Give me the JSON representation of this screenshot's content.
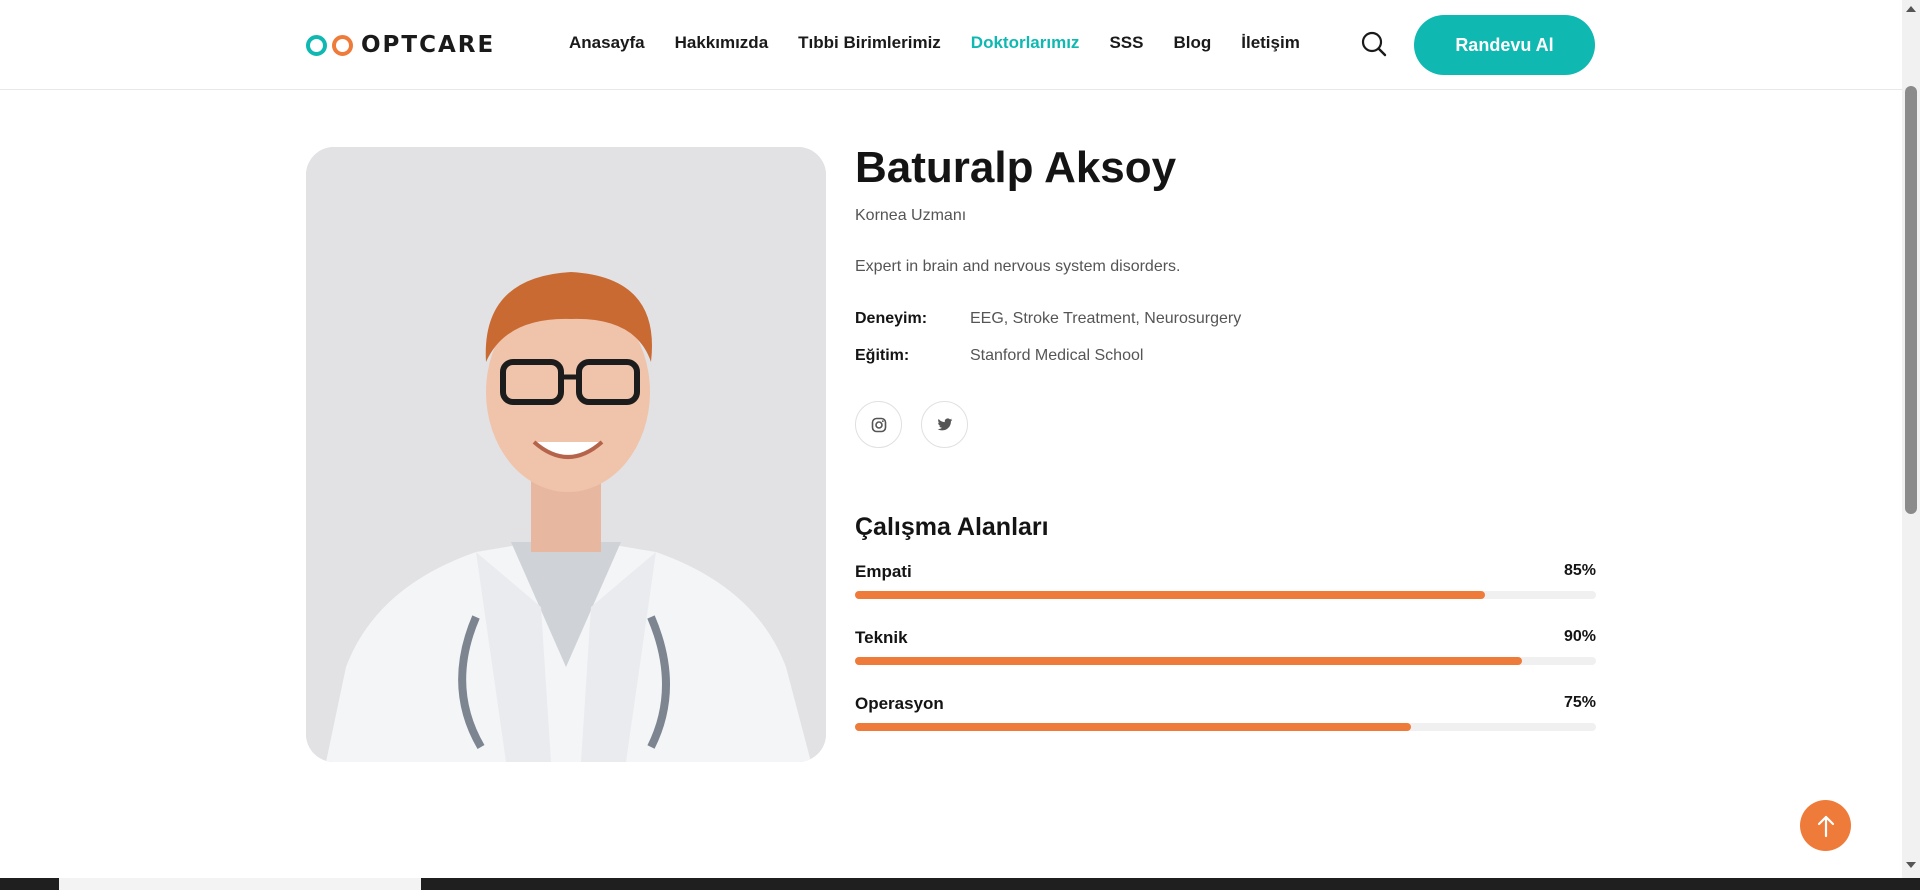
{
  "header": {
    "logo_text": "OPTCARE",
    "nav": [
      {
        "label": "Anasayfa",
        "active": false
      },
      {
        "label": "Hakkımızda",
        "active": false
      },
      {
        "label": "Tıbbi Birimlerimiz",
        "active": false
      },
      {
        "label": "Doktorlarımız",
        "active": true
      },
      {
        "label": "SSS",
        "active": false
      },
      {
        "label": "Blog",
        "active": false
      },
      {
        "label": "İletişim",
        "active": false
      }
    ],
    "cta_label": "Randevu Al"
  },
  "doctor": {
    "name": "Baturalp Aksoy",
    "title": "Kornea Uzmanı",
    "bio": "Expert in brain and nervous system disorders.",
    "experience_label": "Deneyim:",
    "experience_value": "EEG, Stroke Treatment, Neurosurgery",
    "education_label": "Eğitim:",
    "education_value": "Stanford Medical School",
    "social": [
      "instagram-icon",
      "twitter-icon"
    ]
  },
  "skills": {
    "title": "Çalışma Alanları",
    "items": [
      {
        "label": "Empati",
        "percent_text": "85%",
        "value": 85
      },
      {
        "label": "Teknik",
        "percent_text": "90%",
        "value": 90
      },
      {
        "label": "Operasyon",
        "percent_text": "75%",
        "value": 75
      }
    ]
  },
  "colors": {
    "accent": "#0fb8b1",
    "orange": "#ef7b3a"
  }
}
